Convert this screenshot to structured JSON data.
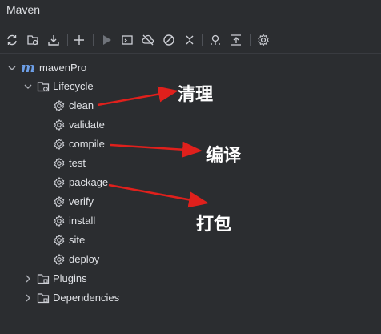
{
  "window": {
    "title": "Maven"
  },
  "toolbar": {
    "icons": [
      "reload-icon",
      "generate-sources-icon",
      "download-icon",
      "add-icon",
      "run-icon",
      "execute-goal-icon",
      "offline-mode-icon",
      "skip-tests-icon",
      "collapse-icon",
      "show-dependencies-icon",
      "collapse-all-icon",
      "settings-icon"
    ]
  },
  "tree": {
    "project": "mavenPro",
    "project_logo": "m",
    "lifecycle": {
      "label": "Lifecycle",
      "items": [
        "clean",
        "validate",
        "compile",
        "test",
        "package",
        "verify",
        "install",
        "site",
        "deploy"
      ]
    },
    "plugins": "Plugins",
    "dependencies": "Dependencies"
  },
  "annotations": {
    "clean": "清理",
    "compile": "编译",
    "package": "打包",
    "color": "#e0201c"
  },
  "colors": {
    "background": "#2b2d30",
    "text": "#dfe1e5",
    "accent": "#6d9fe8"
  }
}
